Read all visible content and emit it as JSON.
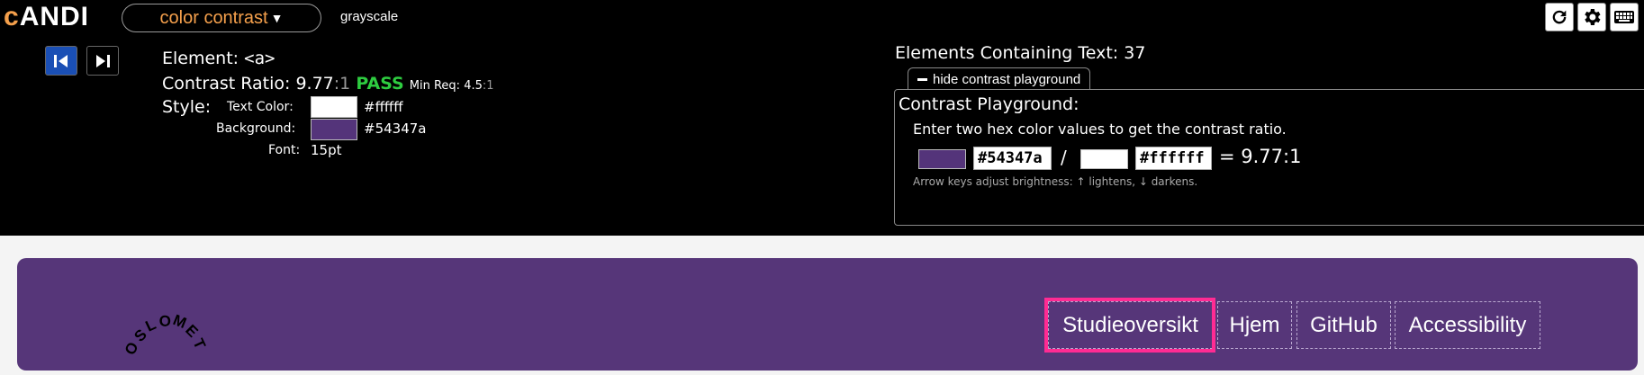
{
  "toolbar": {
    "logo_prefix": "c",
    "logo_rest": "ANDI",
    "module": "color contrast",
    "grayscale": "grayscale",
    "tools": [
      "refresh-icon",
      "gear-icon",
      "keyboard-icon"
    ]
  },
  "element": {
    "label": "Element:",
    "tag": "<a>",
    "contrast_label": "Contrast Ratio:",
    "ratio_value": "9.77",
    "ratio_suffix": ":1",
    "pass": "PASS",
    "min_req_label": "Min Req:",
    "min_req_value": "4.5",
    "min_req_suffix": ":1",
    "style_label": "Style:",
    "text_color_label": "Text Color:",
    "text_color_hex": "#ffffff",
    "background_label": "Background:",
    "background_hex": "#54347a",
    "font_label": "Font:",
    "font_value": "15pt"
  },
  "summary": {
    "elements_text": "Elements Containing Text: 37"
  },
  "playground": {
    "hide_button": "hide contrast playground",
    "title": "Contrast Playground:",
    "instruction": "Enter two hex color values to get the contrast ratio.",
    "fg_hex": "#54347a",
    "slash": "/",
    "bg_hex": "#ffffff",
    "result": "= 9.77:1",
    "hint": "Arrow keys adjust brightness: ↑ lightens, ↓ darkens."
  },
  "site": {
    "logo_letters": [
      "O",
      "S",
      "L",
      "O",
      "M",
      "E",
      "T"
    ],
    "nav": [
      "Studieoversikt",
      "Hjem",
      "GitHub",
      "Accessibility"
    ]
  },
  "colors": {
    "andi_bar": "#000000",
    "accent": "#f5a04c",
    "pass": "#2ecc40",
    "site_bg": "#563679",
    "swatch_bg": "#54347a",
    "swatch_text": "#ffffff",
    "highlight": "#ff2b93"
  }
}
